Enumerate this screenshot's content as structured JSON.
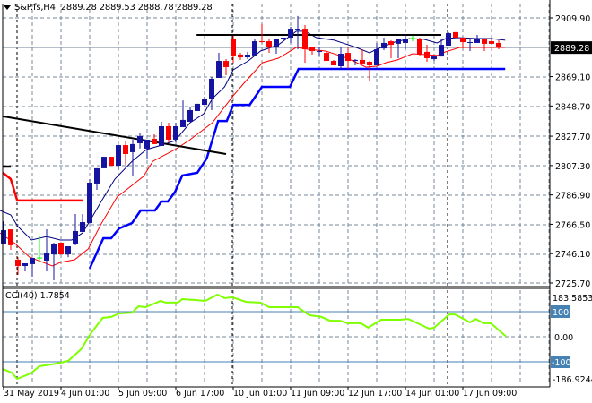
{
  "header": {
    "symbol": "S&P.fs,H4",
    "ohlc": "2889.28 2889.53 2888.78 2889.28"
  },
  "cci_header": {
    "label": "CCI(40) 1.7854"
  },
  "colors": {
    "bull": "#1414a0",
    "bear": "#ff0000",
    "ma_fast": "#000080",
    "ma_slow": "#ff0000",
    "stop_blue": "#0000ff",
    "stop_red": "#ff0000",
    "trend": "#000000",
    "cci": "#7fff00",
    "grid": "#778899",
    "level": "#4682b4"
  },
  "chart_data": [
    {
      "type": "candlestick",
      "title": "S&P.fs,H4",
      "ylim": [
        2725.7,
        2909.9
      ],
      "yticks": [
        "2909.90",
        "2869.10",
        "2848.70",
        "2827.70",
        "2807.30",
        "2786.90",
        "2766.50",
        "2746.10",
        "2725.70"
      ],
      "current_price": "2889.28",
      "grid": true,
      "separators_at_bar": [
        2,
        32,
        62
      ],
      "candles_ohlc": [
        [
          2752.5,
          2768.6,
          2752.5,
          2762.4
        ],
        [
          2763.0,
          2763.0,
          2748.7,
          2751.9
        ],
        [
          2741.9,
          2743.7,
          2731.3,
          2737.5
        ],
        [
          2737.5,
          2739.4,
          2733.8,
          2739.4
        ],
        [
          2738.8,
          2743.1,
          2730.1,
          2743.1
        ],
        [
          2743.1,
          2758.7,
          2740.6,
          2743.1
        ],
        [
          2741.3,
          2763.0,
          2733.8,
          2746.8
        ],
        [
          2745.6,
          2753.7,
          2727.6,
          2752.5
        ],
        [
          2753.7,
          2753.7,
          2745.6,
          2745.6
        ],
        [
          2745.6,
          2751.2,
          2743.7,
          2751.2
        ],
        [
          2752.5,
          2773.6,
          2751.9,
          2761.8
        ],
        [
          2761.2,
          2773.6,
          2761.2,
          2768.0
        ],
        [
          2767.4,
          2797.9,
          2767.4,
          2795.4
        ],
        [
          2794.8,
          2805.4,
          2790.4,
          2805.4
        ],
        [
          2805.4,
          2813.4,
          2805.4,
          2813.4
        ],
        [
          2813.4,
          2813.4,
          2807.2,
          2807.2
        ],
        [
          2807.2,
          2821.5,
          2804.1,
          2821.5
        ],
        [
          2821.5,
          2824.0,
          2807.9,
          2815.3
        ],
        [
          2816.6,
          2825.3,
          2800.4,
          2822.2
        ],
        [
          2822.8,
          2830.2,
          2819.1,
          2827.8
        ],
        [
          2819.1,
          2825.3,
          2811.6,
          2825.3
        ],
        [
          2825.9,
          2829.0,
          2822.2,
          2822.2
        ],
        [
          2820.9,
          2837.7,
          2820.9,
          2834.6
        ],
        [
          2834.6,
          2837.1,
          2823.4,
          2825.3
        ],
        [
          2825.3,
          2837.1,
          2823.4,
          2834.6
        ],
        [
          2834.0,
          2852.6,
          2834.0,
          2839.0
        ],
        [
          2837.7,
          2847.7,
          2837.7,
          2845.8
        ],
        [
          2845.2,
          2850.2,
          2845.2,
          2850.2
        ],
        [
          2849.5,
          2855.1,
          2849.5,
          2853.3
        ],
        [
          2853.3,
          2868.8,
          2845.8,
          2867.6
        ],
        [
          2868.2,
          2885.6,
          2868.2,
          2880.0
        ],
        [
          2880.0,
          2881.3,
          2870.1,
          2875.7
        ],
        [
          2895.6,
          2897.5,
          2878.8,
          2883.8
        ],
        [
          2884.4,
          2885.6,
          2880.7,
          2882.5
        ],
        [
          2882.5,
          2886.3,
          2881.3,
          2884.4
        ],
        [
          2883.8,
          2895.6,
          2883.8,
          2893.7
        ],
        [
          2893.7,
          2905.6,
          2892.5,
          2893.1
        ],
        [
          2893.7,
          2895.6,
          2885.6,
          2889.4
        ],
        [
          2890.0,
          2895.6,
          2885.0,
          2895.0
        ],
        [
          2895.0,
          2896.2,
          2894.4,
          2896.2
        ],
        [
          2896.2,
          2903.7,
          2892.5,
          2902.4
        ],
        [
          2901.8,
          2911.2,
          2888.1,
          2902.4
        ],
        [
          2902.4,
          2905.0,
          2878.8,
          2888.1
        ],
        [
          2889.4,
          2889.4,
          2884.4,
          2886.9
        ],
        [
          2886.3,
          2890.0,
          2883.8,
          2886.9
        ],
        [
          2885.6,
          2886.3,
          2880.0,
          2880.0
        ],
        [
          2880.0,
          2880.7,
          2876.9,
          2876.9
        ],
        [
          2876.3,
          2889.4,
          2874.4,
          2885.0
        ],
        [
          2885.6,
          2889.4,
          2874.4,
          2880.0
        ],
        [
          2880.0,
          2881.3,
          2876.9,
          2880.7
        ],
        [
          2880.7,
          2888.1,
          2878.2,
          2878.2
        ],
        [
          2879.4,
          2880.0,
          2866.3,
          2876.9
        ],
        [
          2876.9,
          2892.5,
          2876.9,
          2888.1
        ],
        [
          2888.7,
          2896.2,
          2887.5,
          2892.5
        ],
        [
          2893.7,
          2894.4,
          2881.9,
          2891.2
        ],
        [
          2891.9,
          2895.6,
          2881.9,
          2895.0
        ],
        [
          2892.5,
          2898.7,
          2888.1,
          2895.0
        ],
        [
          2895.6,
          2897.5,
          2893.7,
          2895.6
        ],
        [
          2895.6,
          2896.2,
          2883.8,
          2884.4
        ],
        [
          2886.3,
          2891.2,
          2879.4,
          2881.9
        ],
        [
          2881.3,
          2883.1,
          2880.0,
          2883.1
        ],
        [
          2883.1,
          2895.0,
          2883.1,
          2891.2
        ],
        [
          2890.6,
          2900.0,
          2890.6,
          2899.3
        ],
        [
          2900.0,
          2900.0,
          2896.2,
          2896.2
        ],
        [
          2896.2,
          2896.2,
          2888.7,
          2893.1
        ],
        [
          2892.5,
          2895.6,
          2886.9,
          2893.1
        ],
        [
          2892.5,
          2898.1,
          2892.5,
          2895.6
        ],
        [
          2895.6,
          2895.6,
          2886.9,
          2891.9
        ],
        [
          2893.7,
          2895.6,
          2891.9,
          2891.9
        ],
        [
          2892.5,
          2894.4,
          2888.1,
          2889.28
        ]
      ],
      "doji_bars": [
        5,
        57
      ],
      "series": [
        {
          "name": "ma_fast",
          "points": [
            [
              -0.5,
              2776.1
            ],
            [
              1,
              2773.0
            ],
            [
              2,
              2764.9
            ],
            [
              3.9,
              2755.6
            ],
            [
              6,
              2758.0
            ],
            [
              7.9,
              2755.6
            ],
            [
              9.5,
              2755.6
            ],
            [
              11,
              2760.5
            ],
            [
              12,
              2768.6
            ],
            [
              13.6,
              2782.3
            ],
            [
              15.5,
              2797.9
            ],
            [
              17.9,
              2810.3
            ],
            [
              19.9,
              2818.4
            ],
            [
              22,
              2821.5
            ],
            [
              23.9,
              2824.6
            ],
            [
              26,
              2837.1
            ],
            [
              27.9,
              2843.3
            ],
            [
              29.1,
              2853.9
            ],
            [
              30.8,
              2862.0
            ],
            [
              32,
              2873.8
            ],
            [
              34.1,
              2880.0
            ],
            [
              35.8,
              2886.9
            ],
            [
              38.3,
              2891.2
            ],
            [
              40.8,
              2900.6
            ],
            [
              42,
              2900.6
            ],
            [
              43.6,
              2896.2
            ],
            [
              46.1,
              2894.4
            ],
            [
              49.1,
              2889.4
            ],
            [
              51,
              2885.6
            ],
            [
              52,
              2888.1
            ],
            [
              54.5,
              2893.1
            ],
            [
              56.6,
              2895.6
            ],
            [
              58.6,
              2895.0
            ],
            [
              60.4,
              2892.5
            ],
            [
              61.6,
              2895.6
            ],
            [
              63.3,
              2896.2
            ],
            [
              65.8,
              2895.6
            ],
            [
              67.9,
              2895.6
            ],
            [
              69.9,
              2894.4
            ]
          ]
        },
        {
          "name": "ma_slow",
          "points": [
            [
              -0.5,
              2760.5
            ],
            [
              1.6,
              2753.1
            ],
            [
              3.6,
              2743.7
            ],
            [
              6.8,
              2737.5
            ],
            [
              7.9,
              2740.0
            ],
            [
              9.9,
              2741.9
            ],
            [
              11.8,
              2749.4
            ],
            [
              13.6,
              2766.8
            ],
            [
              15.8,
              2785.4
            ],
            [
              17.9,
              2793.5
            ],
            [
              19.5,
              2799.8
            ],
            [
              20.8,
              2810.3
            ],
            [
              23.9,
              2818.4
            ],
            [
              25.8,
              2824.6
            ],
            [
              29.1,
              2837.1
            ],
            [
              32,
              2855.8
            ],
            [
              33.6,
              2865.1
            ],
            [
              36.1,
              2878.8
            ],
            [
              38.3,
              2881.9
            ],
            [
              40.8,
              2889.4
            ],
            [
              42.4,
              2888.1
            ],
            [
              44.9,
              2886.9
            ],
            [
              47.9,
              2881.9
            ],
            [
              50.5,
              2875.7
            ],
            [
              52,
              2876.3
            ],
            [
              53.3,
              2878.8
            ],
            [
              54.9,
              2880.7
            ],
            [
              57,
              2885.0
            ],
            [
              60.4,
              2883.8
            ],
            [
              61.6,
              2886.3
            ],
            [
              63.6,
              2889.4
            ],
            [
              69.9,
              2889.4
            ]
          ]
        },
        {
          "name": "stop_blue",
          "points": [
            [
              12,
              2735.7
            ],
            [
              13.9,
              2756.8
            ],
            [
              15,
              2756.8
            ],
            [
              16.1,
              2763.6
            ],
            [
              17.9,
              2767.4
            ],
            [
              19.1,
              2776.1
            ],
            [
              21.1,
              2776.1
            ],
            [
              22,
              2782.3
            ],
            [
              22.9,
              2782.3
            ],
            [
              23.9,
              2789.1
            ],
            [
              24.9,
              2800.4
            ],
            [
              27,
              2802.3
            ],
            [
              28.3,
              2812.2
            ],
            [
              29.9,
              2838.3
            ],
            [
              31.1,
              2838.3
            ],
            [
              32,
              2849.5
            ],
            [
              34.3,
              2849.5
            ],
            [
              36,
              2862.0
            ],
            [
              39.9,
              2862.0
            ],
            [
              40.8,
              2871.3
            ],
            [
              41.1,
              2874.4
            ],
            [
              69.9,
              2874.4
            ]
          ]
        },
        {
          "name": "stop_red",
          "points": [
            [
              -0.1,
              2802.3
            ],
            [
              1,
              2797.9
            ],
            [
              1.9,
              2783.0
            ],
            [
              11,
              2783.0
            ]
          ]
        },
        {
          "name": "stop_black",
          "points": [
            [
              -0.1,
              2806.6
            ],
            [
              1,
              2806.6
            ]
          ]
        },
        {
          "name": "trendline_down",
          "points": [
            [
              -0.1,
              2841.5
            ],
            [
              31,
              2815.3
            ]
          ]
        },
        {
          "name": "resistance_line",
          "points": [
            [
              26.9,
              2898.1
            ],
            [
              61,
              2898.1
            ]
          ]
        }
      ],
      "x_labels": [
        {
          "bar": 0,
          "text": "31 May 2019"
        },
        {
          "bar": 8,
          "text": "4 Jun 01:00"
        },
        {
          "bar": 16,
          "text": "5 Jun 09:00"
        },
        {
          "bar": 24,
          "text": "6 Jun 17:00"
        },
        {
          "bar": 32,
          "text": "10 Jun 01:00"
        },
        {
          "bar": 40,
          "text": "11 Jun 09:00"
        },
        {
          "bar": 48,
          "text": "12 Jun 17:00"
        },
        {
          "bar": 56,
          "text": "14 Jun 01:00"
        },
        {
          "bar": 64,
          "text": "17 Jun 09:00"
        }
      ]
    },
    {
      "type": "line",
      "title": "CCI(40)",
      "last_value": "1.7854",
      "ylim": [
        -186.9244,
        183.5853
      ],
      "yticks": {
        "max": "183.5853",
        "upper": "100",
        "zero": "0.00",
        "lower": "-100",
        "min": "-186.9244"
      },
      "levels": [
        100,
        -100
      ],
      "points": [
        [
          -0.1,
          -129
        ],
        [
          1.1,
          -143
        ],
        [
          1.9,
          -168
        ],
        [
          3.8,
          -146
        ],
        [
          5,
          -118
        ],
        [
          7.4,
          -107
        ],
        [
          9,
          -96
        ],
        [
          10.8,
          -50
        ],
        [
          12.1,
          11
        ],
        [
          13.8,
          75
        ],
        [
          15,
          79
        ],
        [
          16.1,
          93
        ],
        [
          17.9,
          96
        ],
        [
          18.8,
          121
        ],
        [
          19.8,
          118
        ],
        [
          21.9,
          143
        ],
        [
          22.6,
          136
        ],
        [
          24.3,
          136
        ],
        [
          24.9,
          150
        ],
        [
          26.9,
          146
        ],
        [
          28.1,
          143
        ],
        [
          29.8,
          168
        ],
        [
          30.8,
          154
        ],
        [
          31.9,
          157
        ],
        [
          33.8,
          139
        ],
        [
          35.8,
          136
        ],
        [
          37,
          118
        ],
        [
          41,
          118
        ],
        [
          42.6,
          86
        ],
        [
          44.3,
          79
        ],
        [
          45.5,
          64
        ],
        [
          46.9,
          64
        ],
        [
          47.9,
          54
        ],
        [
          49.8,
          54
        ],
        [
          50.8,
          36
        ],
        [
          52.6,
          68
        ],
        [
          55.3,
          68
        ],
        [
          56.4,
          71
        ],
        [
          59.3,
          32
        ],
        [
          60,
          36
        ],
        [
          62.1,
          89
        ],
        [
          62.9,
          89
        ],
        [
          65,
          57
        ],
        [
          65.8,
          71
        ],
        [
          66.9,
          54
        ],
        [
          67.9,
          54
        ],
        [
          70,
          1.7854
        ]
      ]
    }
  ]
}
